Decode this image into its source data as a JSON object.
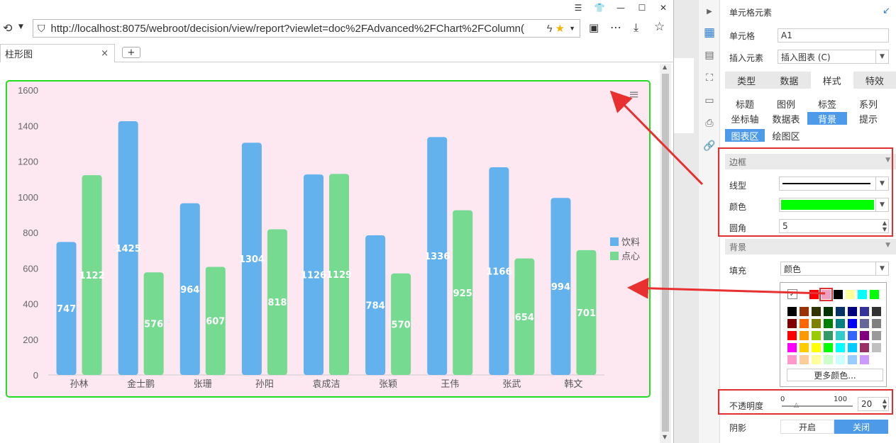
{
  "browser": {
    "url": "http://localhost:8075/webroot/decision/view/report?viewlet=doc%2FAdvanced%2FChart%2FColumn(",
    "tab_title": "柱形图",
    "new_tab": "+",
    "tab_close": "×"
  },
  "chart_data": {
    "type": "bar",
    "categories": [
      "孙林",
      "金士鹏",
      "张珊",
      "孙阳",
      "袁成洁",
      "张颖",
      "王伟",
      "张武",
      "韩文"
    ],
    "series": [
      {
        "name": "饮料",
        "values": [
          747,
          1425,
          964,
          1304,
          1126,
          784,
          1336,
          1166,
          994
        ],
        "color": "#63b2ee"
      },
      {
        "name": "点心",
        "values": [
          1122,
          576,
          607,
          818,
          1129,
          570,
          925,
          654,
          701
        ],
        "color": "#76da91"
      }
    ],
    "y_ticks": [
      "0",
      "200",
      "400",
      "600",
      "800",
      "1000",
      "1200",
      "1400",
      "1600"
    ],
    "ylim": [
      0,
      1600
    ],
    "legend_position": "right",
    "background": "#fde8f2",
    "border_color": "#22dd22"
  },
  "panel": {
    "header": "单元格元素",
    "cell_label": "单元格",
    "cell_value": "A1",
    "insert_label": "插入元素",
    "insert_value": "插入图表 (C)",
    "tabs": [
      "类型",
      "数据",
      "样式",
      "特效"
    ],
    "subtabs": [
      "标题",
      "图例",
      "标签",
      "系列",
      "坐标轴",
      "数据表",
      "背景",
      "提示",
      "图表区",
      "绘图区"
    ],
    "border_section": "边框",
    "line_label": "线型",
    "color_label": "颜色",
    "radius_label": "圆角",
    "radius_value": "5",
    "border_color": "#00ff00",
    "bg_section": "背景",
    "fill_label": "填充",
    "fill_value": "颜色",
    "more_colors": "更多颜色...",
    "opacity_label": "不透明度",
    "opacity_min": "0",
    "opacity_max": "100",
    "opacity_value": "20",
    "shadow_label": "阴影",
    "shadow_on": "开启",
    "shadow_off": "关闭"
  }
}
